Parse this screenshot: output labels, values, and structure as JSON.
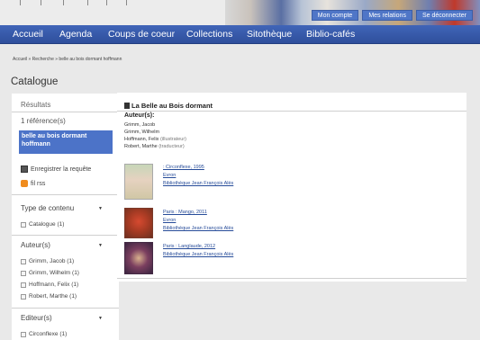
{
  "header": {
    "links": [
      "Mon compte",
      "Mes relations",
      "Se déconnecter"
    ]
  },
  "nav": {
    "items": [
      "Accueil",
      "Agenda",
      "Coups de coeur",
      "Collections",
      "Sitothèque",
      "Biblio-cafés"
    ]
  },
  "breadcrumb": "Accueil » Recherche » belle au bois dormant hoffmann",
  "page_title": "Catalogue",
  "sidebar": {
    "results_heading": "Résultats",
    "count": "1 référence(s)",
    "query": "belle au bois dormant hoffmann",
    "save_label": "Enregistrer la requête",
    "rss_label": "fil rss",
    "facets": [
      {
        "title": "Type de contenu",
        "items": [
          "Catalogue (1)"
        ]
      },
      {
        "title": "Auteur(s)",
        "items": [
          "Grimm, Jacob (1)",
          "Grimm, Wilhelm (1)",
          "Hoffmann, Felix (1)",
          "Robert, Marthe (1)"
        ]
      },
      {
        "title": "Editeur(s)",
        "items": [
          "Circonflexe (1)"
        ]
      }
    ]
  },
  "record": {
    "title": "La Belle au Bois dormant",
    "authors_heading": "Auteur(s):",
    "authors": [
      {
        "name": "Grimm, Jacob",
        "role": ""
      },
      {
        "name": "Grimm, Wilhelm",
        "role": ""
      },
      {
        "name": "Hoffmann, Felix",
        "role": "(illustrateur)"
      },
      {
        "name": "Robert, Marthe",
        "role": "(traducteur)"
      }
    ],
    "editions": [
      {
        "line1": ": Circonflexe, 1995",
        "line2": "Evron",
        "line3": "Bibliothèque Jean François Alès"
      },
      {
        "line1": "Paris : Mango, 2011",
        "line2": "Evron",
        "line3": "Bibliothèque Jean François Alès"
      },
      {
        "line1": "Paris : Langlaude, 2012",
        "line2": "Bibliothèque Jean François Alès",
        "line3": ""
      }
    ]
  }
}
